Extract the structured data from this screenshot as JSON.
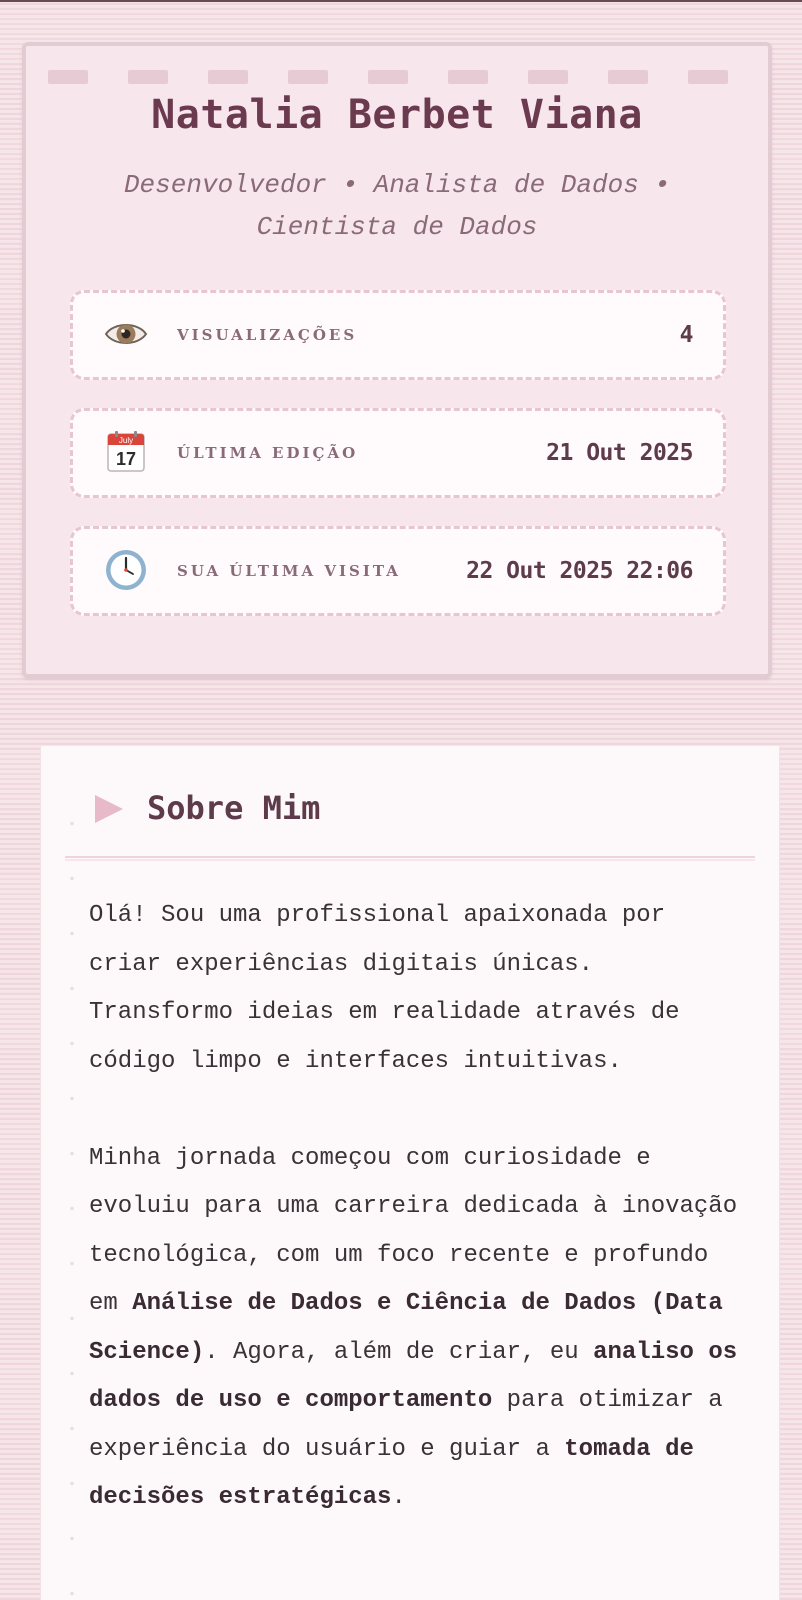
{
  "profile": {
    "name": "Natalia Berbet Viana",
    "subtitle": "Desenvolvedor • Analista de Dados • Cientista de Dados",
    "stats": [
      {
        "icon": "eye-icon",
        "label": "VISUALIZAÇÕES",
        "value": "4"
      },
      {
        "icon": "calendar-icon",
        "label": "ÚLTIMA EDIÇÃO",
        "value": "21 Out 2025",
        "calendar_month": "July",
        "calendar_day": "17"
      },
      {
        "icon": "clock-icon",
        "label": "SUA ÚLTIMA VISITA",
        "value": "22 Out 2025 22:06"
      }
    ]
  },
  "about": {
    "title": "Sobre Mim",
    "paragraph1": "Olá! Sou uma profissional apaixonada por criar experiências digitais únicas. Transformo ideias em realidade através de código limpo e interfaces intuitivas.",
    "p2_part1": "Minha jornada começou com curiosidade e evoluiu para uma carreira dedicada à inovação tecnológica, com um foco recente e profundo em ",
    "p2_bold1": "Análise de Dados e Ciência de Dados (Data Science)",
    "p2_part2": ". Agora, além de criar, eu ",
    "p2_bold2": "analiso os dados de uso e comportamento",
    "p2_part3": " para otimizar a experiência do usuário e guiar a ",
    "p2_bold3": "tomada de decisões estratégicas",
    "p2_part4": "."
  },
  "colors": {
    "background": "#f4e1e6",
    "card": "#f7e7ec",
    "accent": "#6b3a4f",
    "dashed_border": "#e7c6d1",
    "arrow": "#e8b9c9"
  }
}
